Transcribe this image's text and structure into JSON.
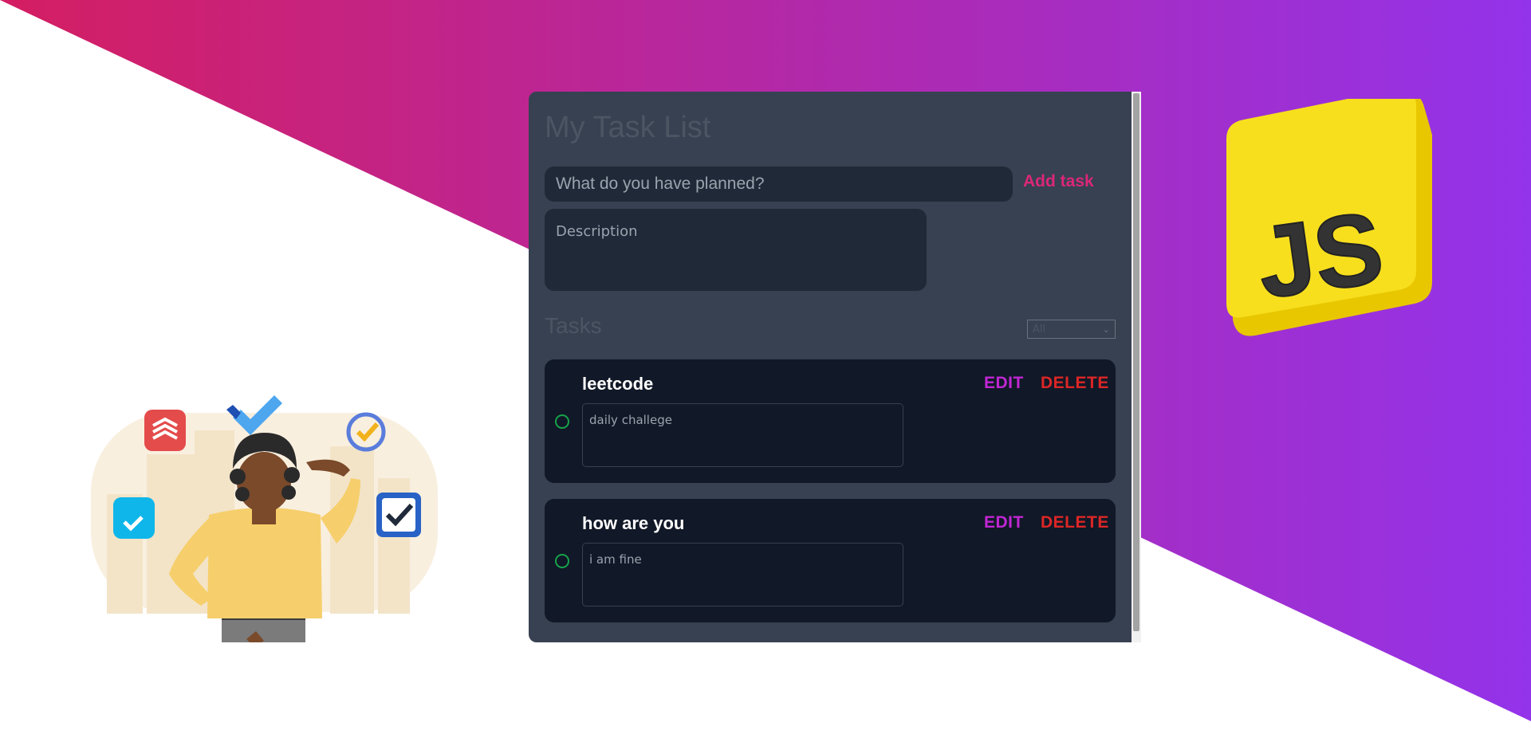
{
  "colors": {
    "gradient_start": "#d41e62",
    "gradient_end": "#9333ea",
    "panel_bg": "#374151",
    "card_bg": "#111827",
    "add_task": "#db2777",
    "edit": "#c026d3",
    "delete": "#dc2626",
    "status_ring": "#16a34a",
    "js_yellow": "#f7df1e"
  },
  "app": {
    "title": "My Task List",
    "task_input_placeholder": "What do you have planned?",
    "add_button_label": "Add task",
    "description_placeholder": "Description",
    "tasks_heading": "Tasks",
    "filter": {
      "selected": "All"
    }
  },
  "tasks": [
    {
      "title": "leetcode",
      "description": "daily challege",
      "edit_label": "EDIT",
      "delete_label": "DELETE"
    },
    {
      "title": "how are you",
      "description": "i am fine",
      "edit_label": "EDIT",
      "delete_label": "DELETE"
    }
  ],
  "logo": {
    "text": "JS"
  },
  "icons": [
    "todoist-icon",
    "microsoft-todo-icon",
    "ticktick-icon",
    "blue-check-icon",
    "checkbox-icon",
    "chevron-down-icon"
  ]
}
